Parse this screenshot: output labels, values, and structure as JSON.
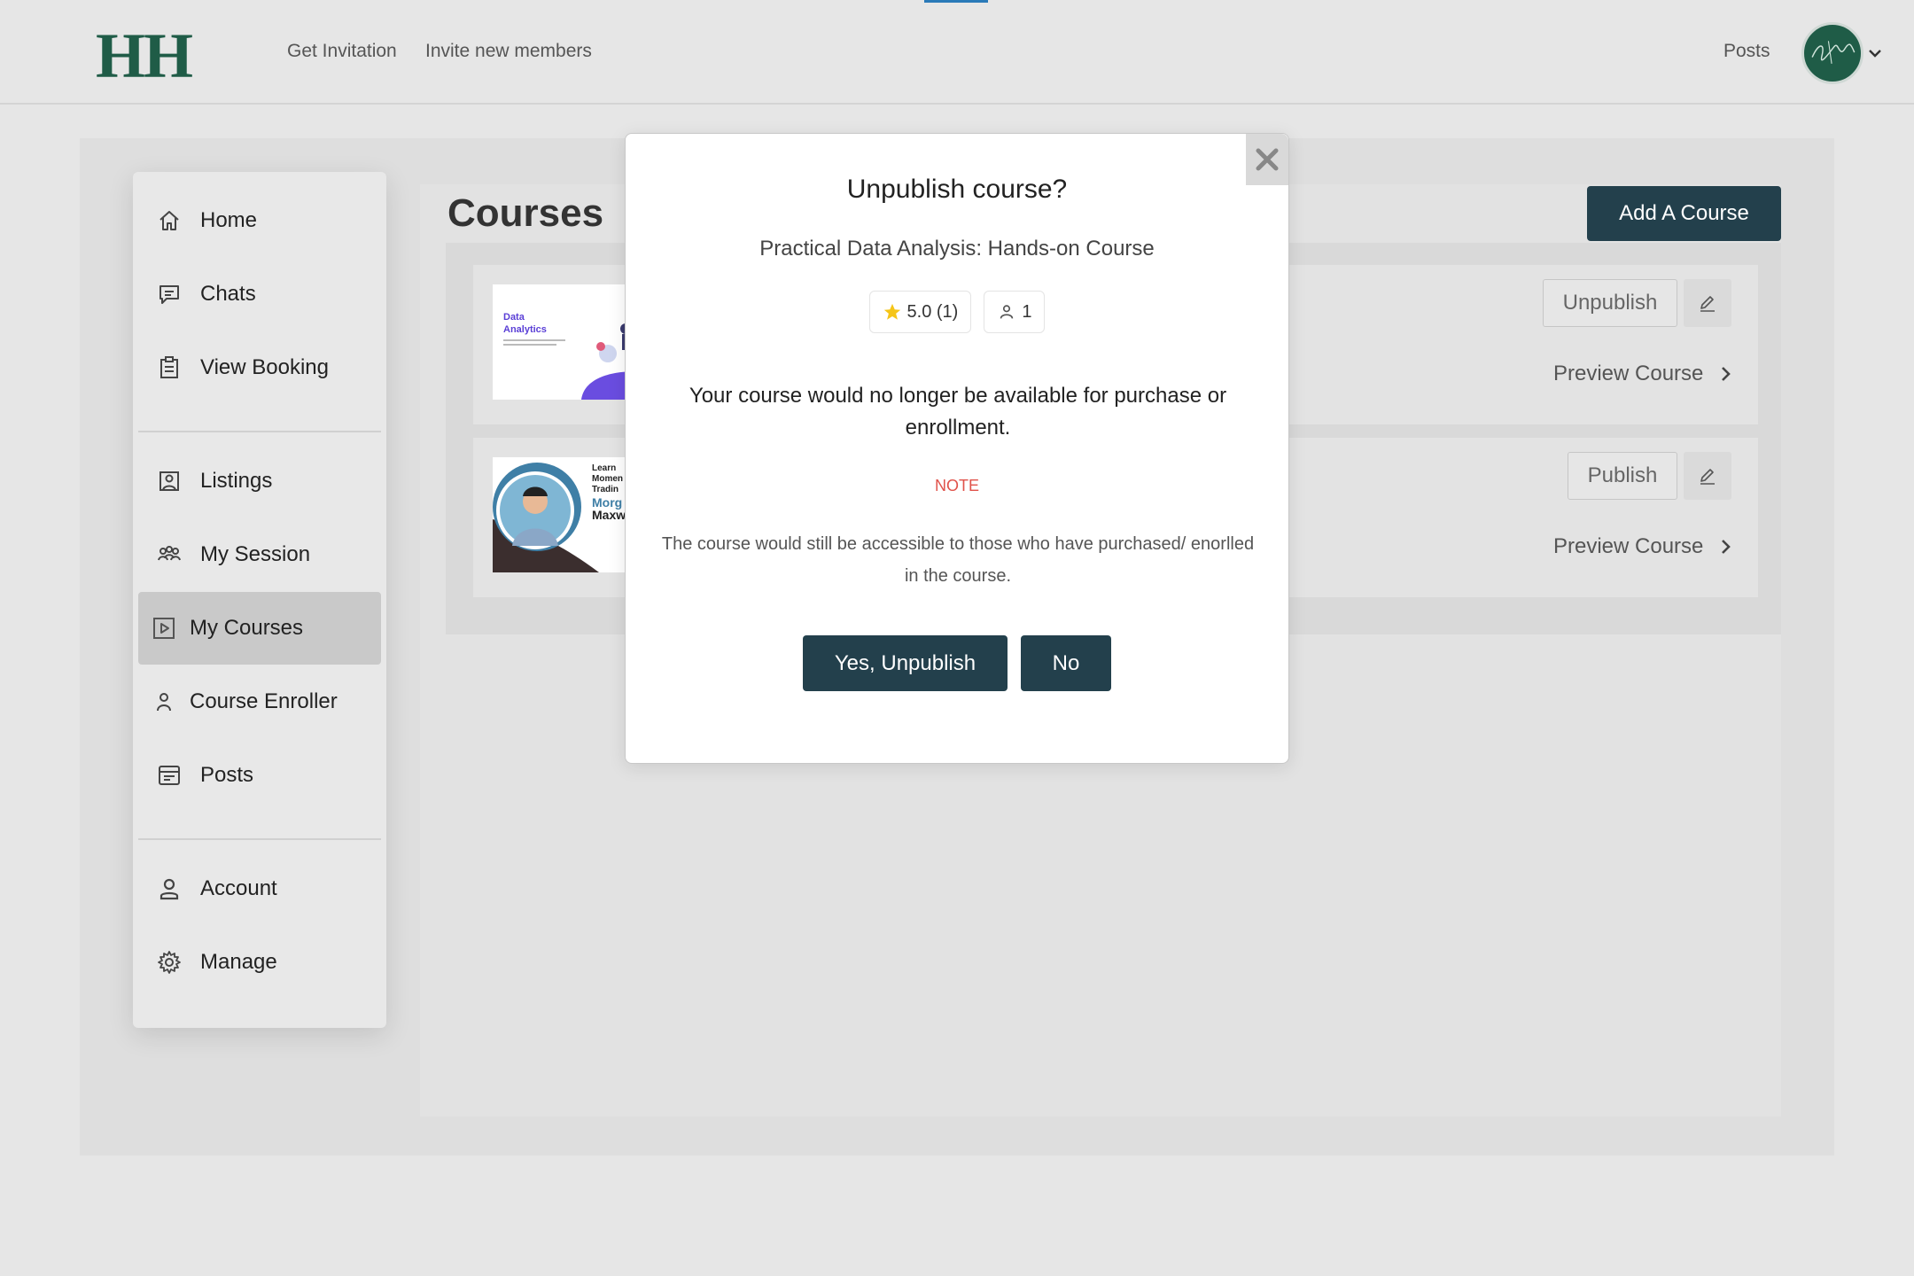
{
  "header": {
    "logo": "HH",
    "links": {
      "get_invitation": "Get Invitation",
      "invite_members": "Invite new members",
      "posts": "Posts"
    }
  },
  "sidebar": {
    "items": [
      {
        "label": "Home",
        "icon": "home-icon"
      },
      {
        "label": "Chats",
        "icon": "chat-icon"
      },
      {
        "label": "View Booking",
        "icon": "clipboard-icon"
      },
      {
        "label": "Listings",
        "icon": "listing-icon"
      },
      {
        "label": "My Session",
        "icon": "group-icon"
      },
      {
        "label": "My Courses",
        "icon": "play-icon",
        "active": true
      },
      {
        "label": "Course Enroller",
        "icon": "user-icon"
      },
      {
        "label": "Posts",
        "icon": "posts-icon"
      },
      {
        "label": "Account",
        "icon": "account-icon"
      },
      {
        "label": "Manage",
        "icon": "gear-icon"
      }
    ]
  },
  "main": {
    "title": "Courses",
    "add_button": "Add A Course",
    "cards": [
      {
        "thumb_text": [
          "Data",
          "Analytics"
        ],
        "status_button": "Unpublish",
        "preview": "Preview Course"
      },
      {
        "thumb_text": [
          "Learn",
          "Momen",
          "Tradin",
          "Morg",
          "Maxw"
        ],
        "status_button": "Publish",
        "preview": "Preview Course"
      }
    ]
  },
  "modal": {
    "title": "Unpublish course?",
    "course_name": "Practical Data Analysis: Hands-on Course",
    "rating": "5.0 (1)",
    "students": "1",
    "body": "Your course would no longer be available for purchase or enrollment.",
    "note_label": "NOTE",
    "note_text": "The course would still be accessible to those who have purchased/ enorlled in the course.",
    "yes_button": "Yes, Unpublish",
    "no_button": "No"
  },
  "colors": {
    "brand": "#1f5c47",
    "primary_button": "#23404c",
    "note": "#e0524a",
    "star": "#f5c518"
  }
}
